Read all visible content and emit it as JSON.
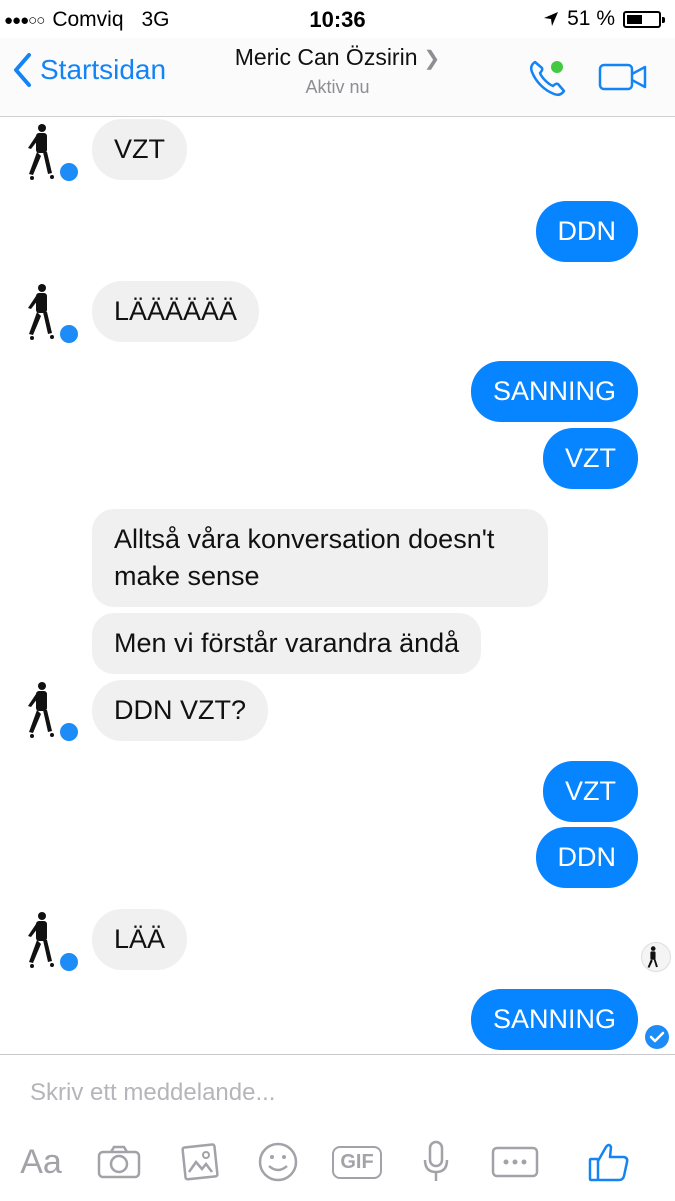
{
  "status_bar": {
    "carrier": "Comviq",
    "network": "3G",
    "time": "10:36",
    "battery": "51 %",
    "battery_level": 0.51
  },
  "nav": {
    "back_label": "Startsidan",
    "contact_name": "Meric Can Özsirin",
    "status": "Aktiv nu",
    "accent_color": "#1484f5"
  },
  "messages": [
    {
      "side": "in",
      "text": "VZT"
    },
    {
      "side": "out",
      "text": "DDN"
    },
    {
      "side": "in",
      "text": "LÄÄÄÄÄÄ"
    },
    {
      "side": "out",
      "text": "SANNING"
    },
    {
      "side": "out",
      "text": "VZT"
    },
    {
      "side": "in",
      "text_line1": "Alltså våra konversation doesn't",
      "text_line2": "make sense"
    },
    {
      "side": "in",
      "text": "Men vi förstår varandra ändå"
    },
    {
      "side": "in",
      "text": "DDN VZT?"
    },
    {
      "side": "out",
      "text": "VZT"
    },
    {
      "side": "out",
      "text": "DDN"
    },
    {
      "side": "in",
      "text": "LÄÄ"
    },
    {
      "side": "out",
      "text": "SANNING"
    }
  ],
  "composer": {
    "placeholder": "Skriv ett meddelande...",
    "text_tool_label": "Aa",
    "gif_label": "GIF"
  },
  "colors": {
    "outgoing_bubble": "#0784ff",
    "incoming_bubble": "#f0f0f0",
    "online_dot": "#44c942"
  }
}
